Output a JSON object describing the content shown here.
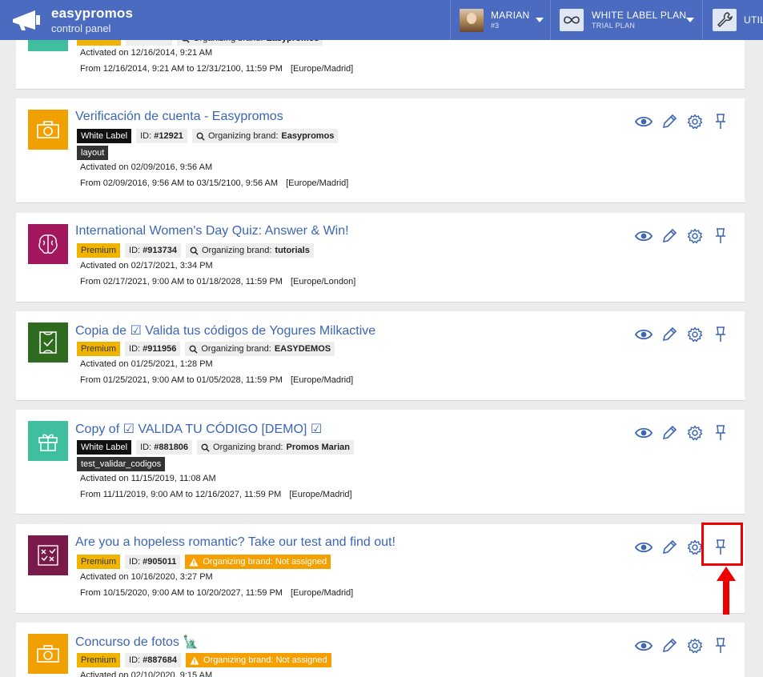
{
  "header": {
    "brand_name": "easypromos",
    "brand_sub": "control panel",
    "user_name": "MARIAN",
    "user_id": "#3",
    "plan_name": "WHITE LABEL PLAN",
    "plan_sub": "TRIAL PLAN",
    "utilities_label": "UTIL"
  },
  "cards": [
    {
      "title": "",
      "id_label": "ID:",
      "org_label": "Organizing brand:",
      "org_name": "Easypromos",
      "activated": "Activated on 12/16/2014, 9:21 AM",
      "period": "From 12/16/2014, 9:21 AM to 12/31/2100, 11:59 PM",
      "timezone": "[Europe/Madrid]"
    },
    {
      "title": "Verificación de cuenta - Easypromos",
      "badge": "White Label",
      "id_label": "ID:",
      "id_value": "#12921",
      "org_label": "Organizing brand:",
      "org_name": "Easypromos",
      "extra_tag": "layout",
      "activated": "Activated on 02/09/2016, 9:56 AM",
      "period": "From 02/09/2016, 9:56 AM to 03/15/2100, 9:56 AM",
      "timezone": "[Europe/Madrid]"
    },
    {
      "title": "International Women's Day Quiz: Answer & Win!",
      "badge": "Premium",
      "id_label": "ID:",
      "id_value": "#913734",
      "org_label": "Organizing brand:",
      "org_name": "tutorials",
      "activated": "Activated on 02/17/2021, 3:34 PM",
      "period": "From 02/17/2021, 9:00 AM to 01/18/2028, 11:59 PM",
      "timezone": "[Europe/London]"
    },
    {
      "title": "Copia de ☑ Valida tus códigos de Yogures Milkactive",
      "badge": "Premium",
      "id_label": "ID:",
      "id_value": "#911956",
      "org_label": "Organizing brand:",
      "org_name": "EASYDEMOS",
      "activated": "Activated on 01/25/2021, 1:28 PM",
      "period": "From 01/25/2021, 9:00 AM to 01/05/2028, 11:59 PM",
      "timezone": "[Europe/Madrid]"
    },
    {
      "title": "Copy of ☑ VALIDA TU CÓDIGO [DEMO] ☑",
      "badge": "White Label",
      "id_label": "ID:",
      "id_value": "#881806",
      "org_label": "Organizing brand:",
      "org_name": "Promos Marian",
      "extra_tag": "test_validar_codigos",
      "activated": "Activated on 11/15/2019, 11:08 AM",
      "period": "From 11/11/2019, 9:00 AM to 12/16/2027, 11:59 PM",
      "timezone": "[Europe/Madrid]"
    },
    {
      "title": "Are you a hopeless romantic? Take our test and find out!",
      "badge": "Premium",
      "id_label": "ID:",
      "id_value": "#905011",
      "org_na": "Organizing brand: Not assigned",
      "activated": "Activated on 10/16/2020, 3:27 PM",
      "period": "From 10/15/2020, 9:00 AM to 10/20/2027, 11:59 PM",
      "timezone": "[Europe/Madrid]"
    },
    {
      "title": "Concurso de fotos 🗽",
      "badge": "Premium",
      "id_label": "ID:",
      "id_value": "#887684",
      "org_na": "Organizing brand: Not assigned",
      "activated": "Activated on 02/10/2020, 9:15 AM"
    }
  ],
  "colors": {
    "header": "#4a6bbf",
    "link": "#3c65b5",
    "premium": "#f0b400",
    "not_assigned": "#f5a000",
    "highlight": "#ee0000"
  }
}
